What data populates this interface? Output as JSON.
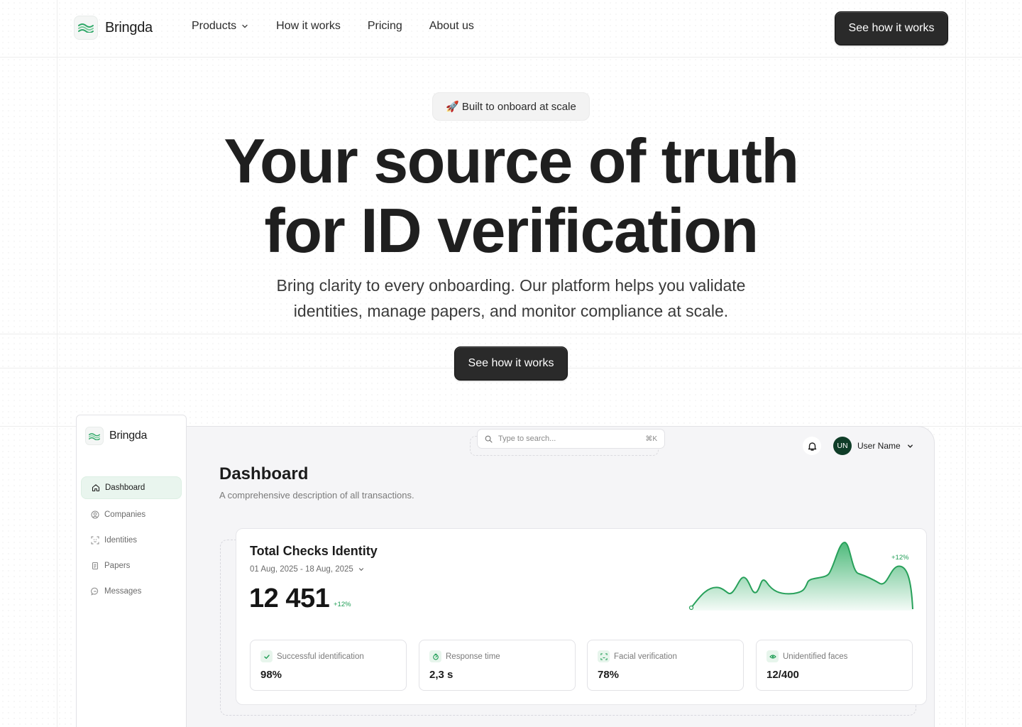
{
  "brand": {
    "name": "Bringda",
    "accent": "#1f9d55"
  },
  "nav": {
    "links": [
      {
        "label": "Products",
        "has_dropdown": true
      },
      {
        "label": "How it works"
      },
      {
        "label": "Pricing"
      },
      {
        "label": "About us"
      }
    ],
    "cta": "See how it works"
  },
  "hero": {
    "badge_emoji": "🚀",
    "badge_text": "Built to onboard at scale",
    "title_line1": "Your source of truth",
    "title_line2": "for ID verification",
    "subtitle_line1": "Bring clarity to every onboarding. Our platform helps you validate",
    "subtitle_line2": "identities, manage papers, and monitor compliance at scale.",
    "cta": "See how it works"
  },
  "app": {
    "brand": "Bringda",
    "sidebar": [
      {
        "label": "Dashboard",
        "icon": "home-icon",
        "active": true
      },
      {
        "label": "Companies",
        "icon": "user-circle-icon"
      },
      {
        "label": "Identities",
        "icon": "face-scan-icon"
      },
      {
        "label": "Papers",
        "icon": "document-icon"
      },
      {
        "label": "Messages",
        "icon": "chat-icon"
      }
    ],
    "search": {
      "placeholder": "Type to search...",
      "shortcut": "⌘K"
    },
    "user": {
      "initials": "UN",
      "name": "User Name"
    },
    "page_title": "Dashboard",
    "page_desc": "A comprehensive description of all transactions.",
    "card": {
      "title": "Total Checks Identity",
      "date_range": "01 Aug, 2025 - 18 Aug, 2025",
      "value": "12 451",
      "change": "+12%",
      "chart_change": "+12%"
    },
    "stats": [
      {
        "label": "Successful identification",
        "value": "98%",
        "icon": "check-icon"
      },
      {
        "label": "Response time",
        "value": "2,3 s",
        "icon": "timer-icon"
      },
      {
        "label": "Facial verification",
        "value": "78%",
        "icon": "face-scan-icon"
      },
      {
        "label": "Unidentified faces",
        "value": "12/400",
        "icon": "eye-icon"
      }
    ]
  }
}
